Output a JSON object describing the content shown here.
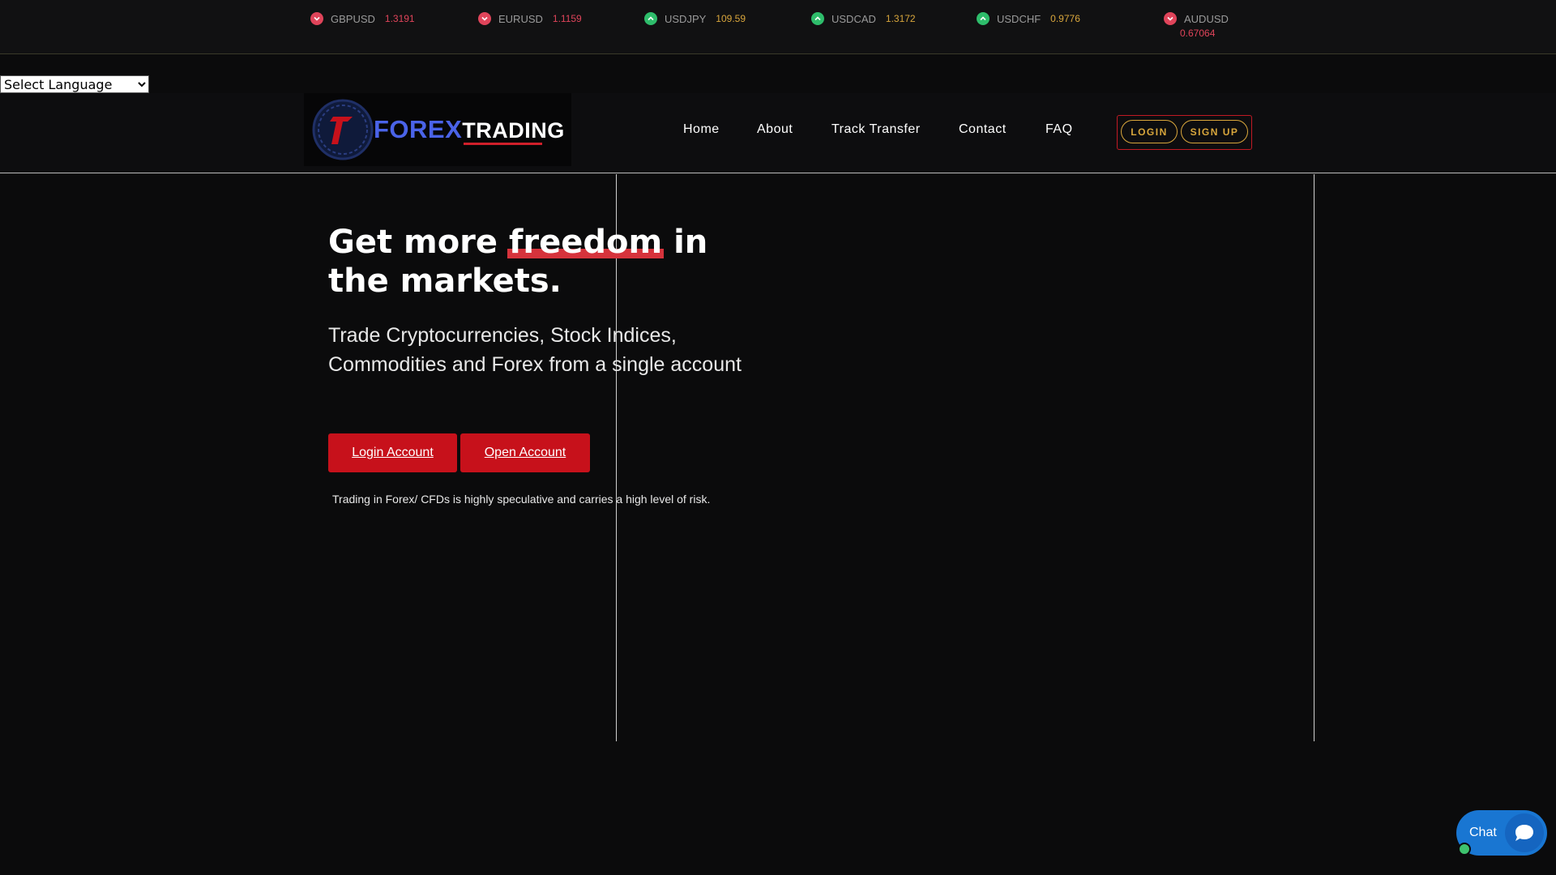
{
  "ticker": [
    {
      "symbol": "GBPUSD",
      "value": "1.3191",
      "direction": "down"
    },
    {
      "symbol": "EURUSD",
      "value": "1.1159",
      "direction": "down"
    },
    {
      "symbol": "USDJPY",
      "value": "109.59",
      "direction": "up"
    },
    {
      "symbol": "USDCAD",
      "value": "1.3172",
      "direction": "up"
    },
    {
      "symbol": "USDCHF",
      "value": "0.9776",
      "direction": "up"
    },
    {
      "symbol": "AUDUSD",
      "value": "0.67064",
      "direction": "down"
    }
  ],
  "language": {
    "selected": "Select Language"
  },
  "logo": {
    "brand_part1": "FOREX",
    "brand_part2": "TRADING"
  },
  "nav": {
    "items": [
      "Home",
      "About",
      "Track Transfer",
      "Contact",
      "FAQ"
    ],
    "login": "LOGIN",
    "signup": "SIGN UP"
  },
  "hero": {
    "title_before": "Get more ",
    "title_highlight": "freedom",
    "title_after": " in the markets.",
    "subtitle": "Trade Cryptocurrencies, Stock Indices, Commodities and Forex from a single account",
    "login_button": "Login Account",
    "open_button": "Open Account",
    "risk_note": "Trading in Forex/ CFDs is highly speculative and carries a high level of risk."
  },
  "chat": {
    "label": "Chat"
  },
  "colors": {
    "accent_red": "#c7111b",
    "gold": "#d8a63c",
    "up_green": "#2ebd6b",
    "down_red": "#e0445a",
    "chat_blue": "#1976d2"
  }
}
